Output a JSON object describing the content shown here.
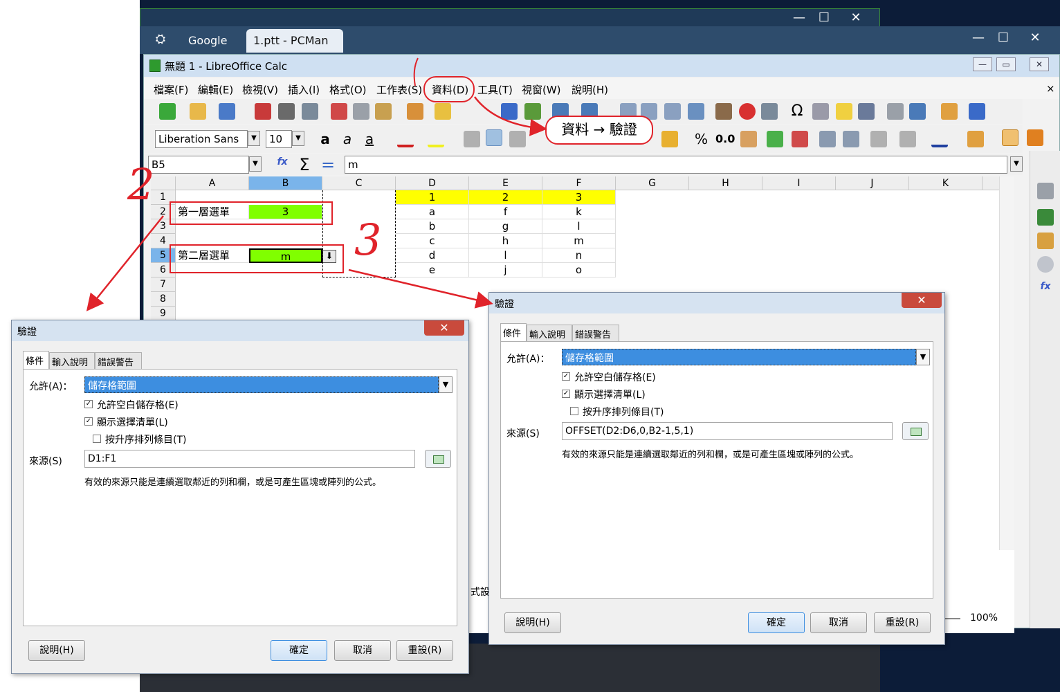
{
  "chrome": {
    "tabs": [
      "Google",
      "1.ptt - PCMan"
    ]
  },
  "calc": {
    "title": "無題 1 - LibreOffice Calc",
    "menu": [
      "檔案(F)",
      "編輯(E)",
      "檢視(V)",
      "插入(I)",
      "格式(O)",
      "工作表(S)",
      "資料(D)",
      "工具(T)",
      "視窗(W)",
      "說明(H)"
    ],
    "font_name": "Liberation Sans",
    "font_size": "10",
    "name_box": "B5",
    "formula_value": "m",
    "number_format_percent": "%",
    "number_format_decimal": "0.0",
    "zoom": "100%",
    "columns": [
      "A",
      "B",
      "C",
      "D",
      "E",
      "F",
      "G",
      "H",
      "I",
      "J",
      "K"
    ],
    "rows": [
      "1",
      "2",
      "3",
      "4",
      "5",
      "6",
      "7",
      "8",
      "9"
    ],
    "cells": {
      "A2": "第一層選單",
      "B2": "3",
      "A5": "第二層選單",
      "B5": "m",
      "D1": "1",
      "E1": "2",
      "F1": "3",
      "D2": "a",
      "E2": "f",
      "F2": "k",
      "D3": "b",
      "E3": "g",
      "F3": "l",
      "D4": "c",
      "E4": "h",
      "F4": "m",
      "D5": "d",
      "E5": "l",
      "F5": "n",
      "D6": "e",
      "E6": "j",
      "F6": "o"
    },
    "partial_text": "式設"
  },
  "annotation": {
    "menu_path": "資料 → 驗證",
    "numbers": [
      "2",
      "3"
    ]
  },
  "dialog_left": {
    "title": "驗證",
    "tabs": [
      "條件",
      "輸入說明",
      "錯誤警告"
    ],
    "allow_label": "允許(A)：",
    "allow_value": "儲存格範圍",
    "check_blank": "允許空白儲存格(E)",
    "check_list": "顯示選擇清單(L)",
    "check_sort": "按升序排列條目(T)",
    "source_label": "來源(S)",
    "source_value": "D1:F1",
    "hint": "有效的來源只能是連續選取鄰近的列和欄，或是可產生區塊或陣列的公式。",
    "help_btn": "說明(H)",
    "ok_btn": "確定",
    "cancel_btn": "取消",
    "reset_btn": "重設(R)"
  },
  "dialog_right": {
    "title": "驗證",
    "tabs": [
      "條件",
      "輸入說明",
      "錯誤警告"
    ],
    "allow_label": "允許(A)：",
    "allow_value": "儲存格範圍",
    "check_blank": "允許空白儲存格(E)",
    "check_list": "顯示選擇清單(L)",
    "check_sort": "按升序排列條目(T)",
    "source_label": "來源(S)",
    "source_value": "OFFSET(D2:D6,0,B2-1,5,1)",
    "hint": "有效的來源只能是連續選取鄰近的列和欄，或是可產生區塊或陣列的公式。",
    "help_btn": "說明(H)",
    "ok_btn": "確定",
    "cancel_btn": "取消",
    "reset_btn": "重設(R)"
  },
  "colors": {
    "accent_red": "#e0232a",
    "cell_green": "#80ff00",
    "cell_yellow": "#ffff00",
    "selection_blue": "#3d8ee0"
  }
}
